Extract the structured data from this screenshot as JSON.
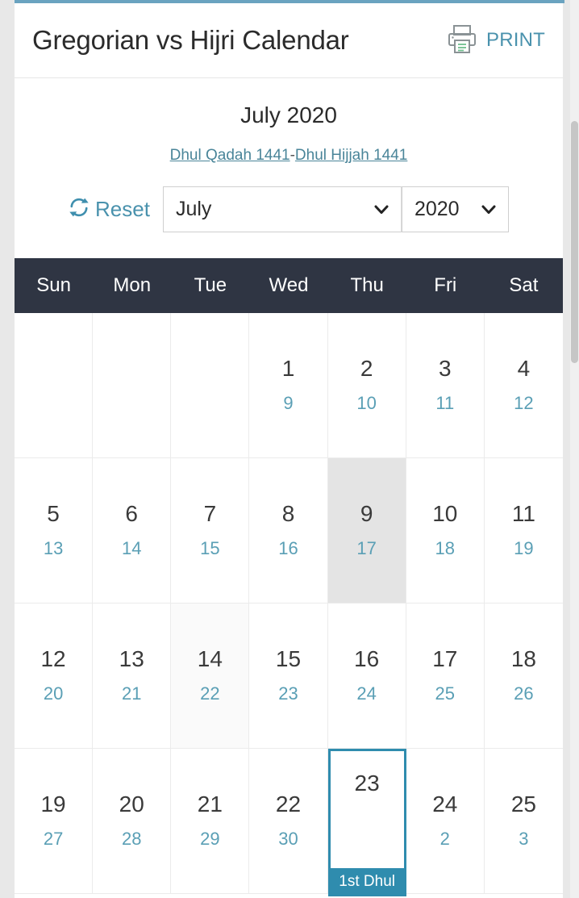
{
  "header": {
    "title": "Gregorian vs Hijri Calendar",
    "print_label": "PRINT",
    "printer_icon": "printer-icon"
  },
  "nav": {
    "month_title": "July 2020",
    "hijri_start": "Dhul Qadah 1441",
    "hijri_separator": "-",
    "hijri_end": "Dhul Hijjah 1441",
    "reset_label": "Reset",
    "reset_icon": "refresh-icon",
    "month_select_value": "July",
    "year_select_value": "2020",
    "chevron_icon": "chevron-down-icon"
  },
  "calendar": {
    "weekdays": [
      "Sun",
      "Mon",
      "Tue",
      "Wed",
      "Thu",
      "Fri",
      "Sat"
    ],
    "accent_color": "#2f8cae",
    "hijri_color": "#5a9fb5",
    "header_bg": "#2f3543",
    "cells": [
      {
        "greg": "",
        "hijri": "",
        "state": "empty"
      },
      {
        "greg": "",
        "hijri": "",
        "state": "empty"
      },
      {
        "greg": "",
        "hijri": "",
        "state": "empty"
      },
      {
        "greg": "1",
        "hijri": "9",
        "state": "normal"
      },
      {
        "greg": "2",
        "hijri": "10",
        "state": "normal"
      },
      {
        "greg": "3",
        "hijri": "11",
        "state": "normal"
      },
      {
        "greg": "4",
        "hijri": "12",
        "state": "normal"
      },
      {
        "greg": "5",
        "hijri": "13",
        "state": "normal"
      },
      {
        "greg": "6",
        "hijri": "14",
        "state": "normal"
      },
      {
        "greg": "7",
        "hijri": "15",
        "state": "normal"
      },
      {
        "greg": "8",
        "hijri": "16",
        "state": "normal"
      },
      {
        "greg": "9",
        "hijri": "17",
        "state": "hover"
      },
      {
        "greg": "10",
        "hijri": "18",
        "state": "normal"
      },
      {
        "greg": "11",
        "hijri": "19",
        "state": "normal"
      },
      {
        "greg": "12",
        "hijri": "20",
        "state": "normal"
      },
      {
        "greg": "13",
        "hijri": "21",
        "state": "normal"
      },
      {
        "greg": "14",
        "hijri": "22",
        "state": "tint"
      },
      {
        "greg": "15",
        "hijri": "23",
        "state": "normal"
      },
      {
        "greg": "16",
        "hijri": "24",
        "state": "normal"
      },
      {
        "greg": "17",
        "hijri": "25",
        "state": "normal"
      },
      {
        "greg": "18",
        "hijri": "26",
        "state": "normal"
      },
      {
        "greg": "19",
        "hijri": "27",
        "state": "normal"
      },
      {
        "greg": "20",
        "hijri": "28",
        "state": "normal"
      },
      {
        "greg": "21",
        "hijri": "29",
        "state": "normal"
      },
      {
        "greg": "22",
        "hijri": "30",
        "state": "normal"
      },
      {
        "greg": "23",
        "hijri": "",
        "state": "selected",
        "event": "1st Dhul"
      },
      {
        "greg": "24",
        "hijri": "2",
        "state": "normal"
      },
      {
        "greg": "25",
        "hijri": "3",
        "state": "normal"
      }
    ]
  }
}
